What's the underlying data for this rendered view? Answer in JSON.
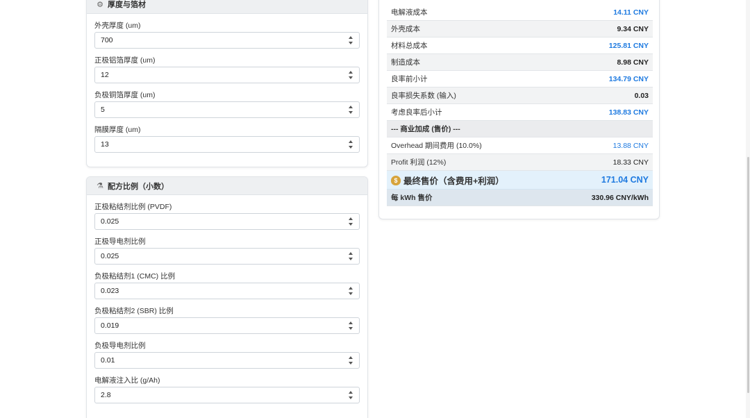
{
  "thickness_card": {
    "title": "厚度与箔材",
    "icon": "gear-icon",
    "fields": [
      {
        "label": "外壳厚度 (um)",
        "value": "700"
      },
      {
        "label": "正极铝箔厚度 (um)",
        "value": "12"
      },
      {
        "label": "负极铜箔厚度 (um)",
        "value": "5"
      },
      {
        "label": "隔膜厚度 (um)",
        "value": "13"
      }
    ]
  },
  "formula_card": {
    "title": "配方比例（小数）",
    "icon": "flask-icon",
    "fields": [
      {
        "label": "正极粘结剂比例 (PVDF)",
        "value": "0.025"
      },
      {
        "label": "正极导电剂比例",
        "value": "0.025"
      },
      {
        "label": "负极粘结剂1 (CMC) 比例",
        "value": "0.023"
      },
      {
        "label": "负极粘结剂2 (SBR) 比例",
        "value": "0.019"
      },
      {
        "label": "负极导电剂比例",
        "value": "0.01"
      },
      {
        "label": "电解液注入比 (g/Ah)",
        "value": "2.8"
      }
    ]
  },
  "summary": {
    "rows": [
      {
        "label": "电解液成本",
        "value": "14.11 CNY",
        "highlight": true
      },
      {
        "label": "外壳成本",
        "value": "9.34 CNY",
        "highlight": false
      },
      {
        "label": "材料总成本",
        "value": "125.81 CNY",
        "highlight": true
      },
      {
        "label": "制造成本",
        "value": "8.98 CNY",
        "highlight": false
      },
      {
        "label": "良率前小计",
        "value": "134.79 CNY",
        "highlight": true
      },
      {
        "label": "良率损失系数 (输入)",
        "value": "0.03",
        "highlight": false
      },
      {
        "label": "考虑良率后小计",
        "value": "138.83 CNY",
        "highlight": true
      }
    ],
    "section_label": "--- 商业加成 (售价) ---",
    "overhead": {
      "label": "Overhead 期间费用 (10.0%)",
      "value": "13.88 CNY"
    },
    "profit": {
      "label": "Profit 利润 (12%)",
      "value": "18.33 CNY"
    },
    "final_price": {
      "label": "最终售价（含费用+利润）",
      "value": "171.04 CNY",
      "icon": "money-bag-icon"
    },
    "per_kwh": {
      "label": "每 kWh 售价",
      "value": "330.96 CNY/kWh"
    }
  },
  "colors": {
    "accent_blue": "#1e7ae0",
    "final_row_bg": "#e3f1fb",
    "header_bg": "#eef0f2"
  }
}
